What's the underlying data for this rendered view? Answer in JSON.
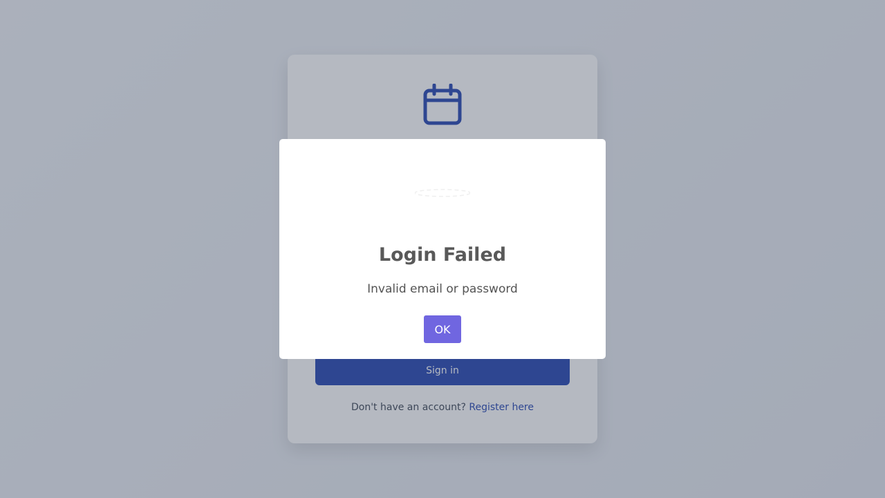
{
  "login_card": {
    "icon": "calendar-icon",
    "sign_in_label": "Sign in",
    "register_prompt": "Don't have an account?",
    "register_link": "Register here"
  },
  "modal": {
    "title": "Login Failed",
    "message": "Invalid email or password",
    "ok_label": "OK",
    "icon": "error-icon"
  },
  "colors": {
    "primary": "#1e40af",
    "confirm_button": "#7066e0",
    "modal_title": "#595959",
    "modal_text": "#545454"
  }
}
